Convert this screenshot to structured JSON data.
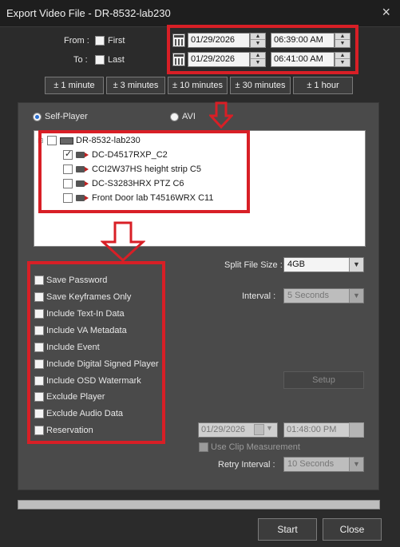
{
  "window": {
    "title": "Export Video File - DR-8532-lab230",
    "close_glyph": "×"
  },
  "range": {
    "from_label": "From :",
    "to_label": "To :",
    "first_label": "First",
    "last_label": "Last",
    "from_date": "01/29/2026",
    "from_time": "06:39:00 AM",
    "to_date": "01/29/2026",
    "to_time": "06:41:00 AM"
  },
  "quick_buttons": [
    "± 1 minute",
    "± 3 minutes",
    "± 10 minutes",
    "± 30 minutes",
    "± 1 hour"
  ],
  "format": {
    "self_player": "Self-Player",
    "avi": "AVI",
    "selected": "Self-Player"
  },
  "tree": {
    "root": "DR-8532-lab230",
    "cameras": [
      {
        "label": "DC-D4517RXP_C2",
        "checked": true
      },
      {
        "label": "CCI2W37HS height strip C5",
        "checked": false
      },
      {
        "label": "DC-S3283HRX PTZ C6",
        "checked": false
      },
      {
        "label": "Front Door lab T4516WRX C11",
        "checked": false
      }
    ]
  },
  "options": [
    "Save Password",
    "Save Keyframes Only",
    "Include Text-In Data",
    "Include VA Metadata",
    "Include Event",
    "Include Digital Signed Player",
    "Include OSD Watermark",
    "Exclude Player",
    "Exclude Audio Data",
    "Reservation"
  ],
  "split": {
    "label": "Split File Size :",
    "value": "4GB"
  },
  "interval": {
    "label": "Interval :",
    "value": "5 Seconds"
  },
  "setup_label": "Setup",
  "reservation": {
    "date": "01/29/2026",
    "time": "01:48:00 PM"
  },
  "use_clip_label": "Use Clip Measurement",
  "retry": {
    "label": "Retry Interval :",
    "value": "10 Seconds"
  },
  "actions": {
    "start": "Start",
    "close": "Close"
  },
  "colors": {
    "highlight": "#d81f26",
    "background": "#2b2b2b",
    "panel": "#4a4a4a"
  }
}
